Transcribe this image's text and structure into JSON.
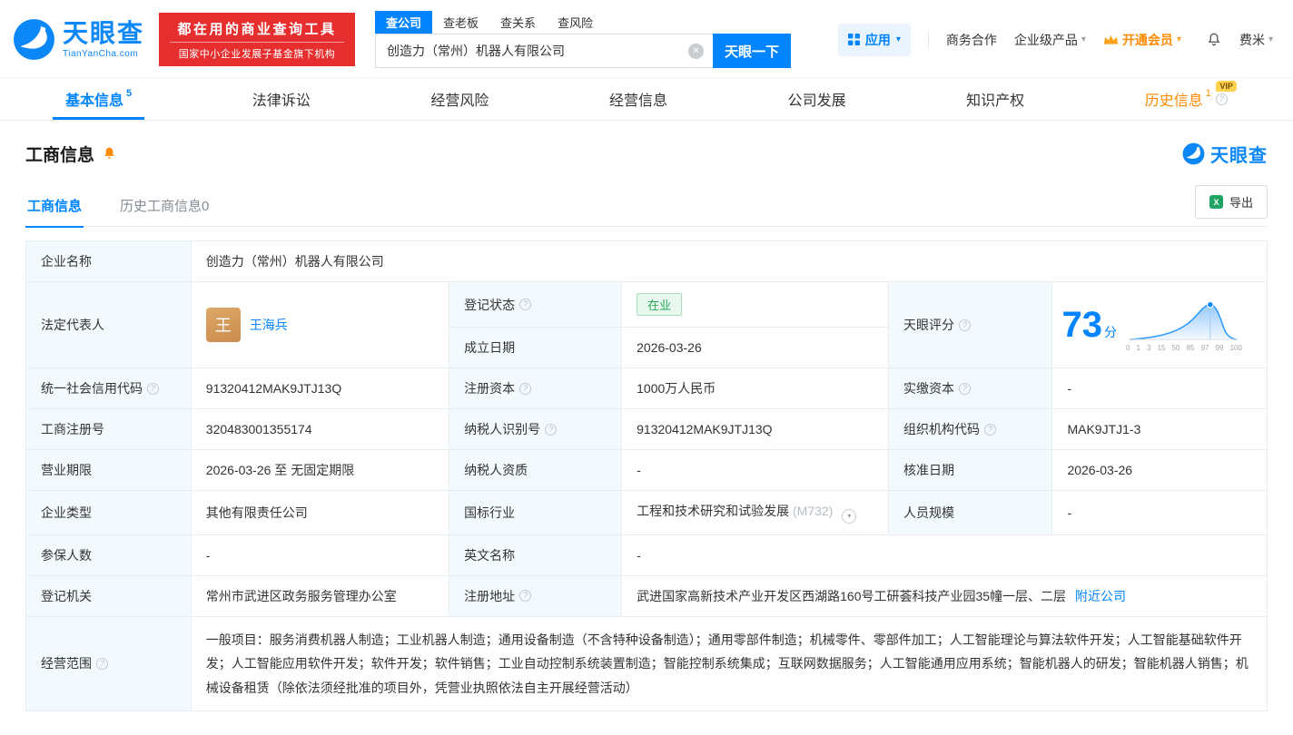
{
  "brand": {
    "name": "天眼查",
    "domain": "TianYanCha.com",
    "banner_line1": "都在用的商业查询工具",
    "banner_line2": "国家中小企业发展子基金旗下机构"
  },
  "search": {
    "tabs": [
      {
        "label": "查公司"
      },
      {
        "label": "查老板"
      },
      {
        "label": "查关系"
      },
      {
        "label": "查风险"
      }
    ],
    "value": "创造力（常州）机器人有限公司",
    "button": "天眼一下"
  },
  "topnav": {
    "app": "应用",
    "cooperation": "商务合作",
    "enterprise": "企业级产品",
    "vip": "开通会员",
    "user": "费米"
  },
  "tabs": [
    {
      "label": "基本信息",
      "badge": "5"
    },
    {
      "label": "法律诉讼"
    },
    {
      "label": "经营风险"
    },
    {
      "label": "经营信息"
    },
    {
      "label": "公司发展"
    },
    {
      "label": "知识产权"
    },
    {
      "label": "历史信息",
      "badge": "1",
      "vip": "VIP"
    }
  ],
  "section": {
    "title": "工商信息",
    "brand": "天眼查",
    "subtab_active": "工商信息",
    "subtab_history": "历史工商信息0",
    "export": "导出"
  },
  "info": {
    "company_name_label": "企业名称",
    "company_name": "创造力（常州）机器人有限公司",
    "legal_rep_label": "法定代表人",
    "legal_rep_avatar": "王",
    "legal_rep": "王海兵",
    "reg_status_label": "登记状态",
    "reg_status": "在业",
    "establish_label": "成立日期",
    "establish_date": "2026-03-26",
    "score_label": "天眼评分",
    "score_value": "73",
    "score_unit": "分",
    "credit_code_label": "统一社会信用代码",
    "credit_code": "91320412MAK9JTJ13Q",
    "reg_capital_label": "注册资本",
    "reg_capital": "1000万人民币",
    "paid_capital_label": "实缴资本",
    "paid_capital": "-",
    "reg_number_label": "工商注册号",
    "reg_number": "320483001355174",
    "taxpayer_id_label": "纳税人识别号",
    "taxpayer_id": "91320412MAK9JTJ13Q",
    "org_code_label": "组织机构代码",
    "org_code": "MAK9JTJ1-3",
    "business_term_label": "营业期限",
    "business_term": "2026-03-26 至 无固定期限",
    "taxpayer_quality_label": "纳税人资质",
    "taxpayer_quality": "-",
    "approval_date_label": "核准日期",
    "approval_date": "2026-03-26",
    "company_type_label": "企业类型",
    "company_type": "其他有限责任公司",
    "industry_label": "国标行业",
    "industry": "工程和技术研究和试验发展",
    "industry_code": "(M732)",
    "staff_size_label": "人员规模",
    "staff_size": "-",
    "insured_label": "参保人数",
    "insured": "-",
    "english_name_label": "英文名称",
    "english_name": "-",
    "reg_authority_label": "登记机关",
    "reg_authority": "常州市武进区政务服务管理办公室",
    "address_label": "注册地址",
    "address": "武进国家高新技术产业开发区西湖路160号工研荟科技产业园35幢一层、二层",
    "nearby_link": "附近公司",
    "scope_label": "经营范围",
    "scope": "一般项目：服务消费机器人制造；工业机器人制造；通用设备制造（不含特种设备制造）；通用零部件制造；机械零件、零部件加工；人工智能理论与算法软件开发；人工智能基础软件开发；人工智能应用软件开发；软件开发；软件销售；工业自动控制系统装置制造；智能控制系统集成；互联网数据服务；人工智能通用应用系统；智能机器人的研发；智能机器人销售；机械设备租赁（除依法须经批准的项目外，凭营业执照依法自主开展经营活动）"
  },
  "icons": {
    "help": "?",
    "caret": "▾",
    "clear": "✕"
  },
  "chart_data": {
    "type": "area",
    "title": "天眼评分分布曲线",
    "score": 73,
    "x_ticks": [
      "0",
      "1",
      "3",
      "15",
      "50",
      "85",
      "97",
      "99",
      "100"
    ]
  },
  "colors": {
    "accent_blue": "#0084ff",
    "banner_red": "#e62e2e",
    "status_green": "#23a757",
    "vip_orange": "#ff8a00",
    "label_bg": "#f3fafe"
  }
}
